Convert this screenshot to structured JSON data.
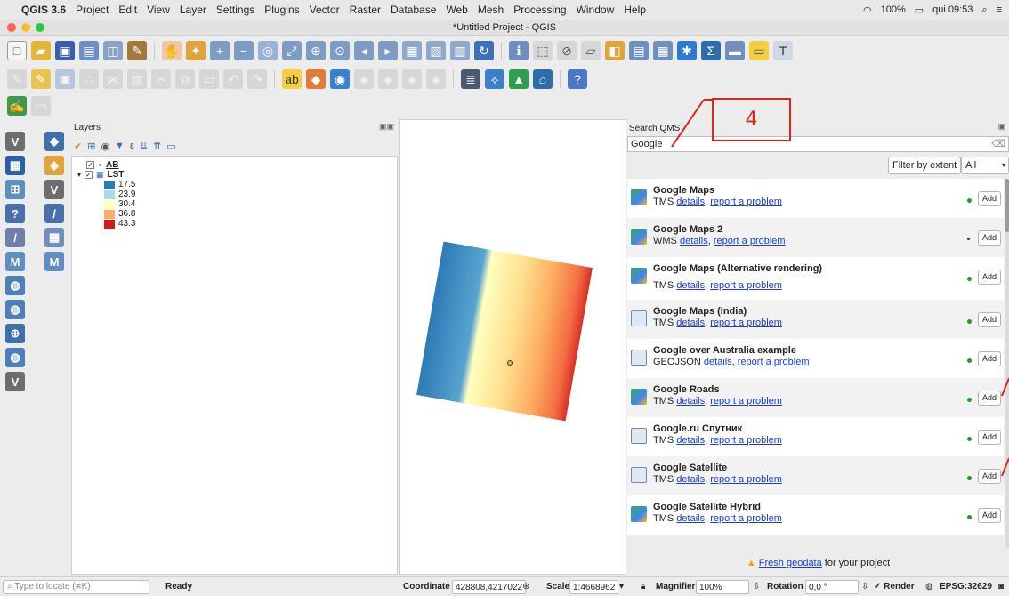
{
  "menubar": {
    "app_name": "QGIS 3.6",
    "items": [
      "Project",
      "Edit",
      "View",
      "Layer",
      "Settings",
      "Plugins",
      "Vector",
      "Raster",
      "Database",
      "Web",
      "Mesh",
      "Processing",
      "Window",
      "Help"
    ],
    "battery": "100%",
    "clock": "qui 09:53"
  },
  "window": {
    "title": "*Untitled Project - QGIS"
  },
  "layers_panel": {
    "title": "Layers",
    "layers": [
      {
        "name": "AB",
        "checked": true
      },
      {
        "name": "LST",
        "checked": true
      }
    ],
    "legend": [
      {
        "label": "17.5",
        "color": "#2c7bb6"
      },
      {
        "label": "23.9",
        "color": "#abd9e9"
      },
      {
        "label": "30.4",
        "color": "#ffffbf"
      },
      {
        "label": "36.8",
        "color": "#fdae61"
      },
      {
        "label": "43.3",
        "color": "#d7191c"
      }
    ]
  },
  "qms": {
    "title": "Search QMS",
    "search_value": "Google",
    "filter_button": "Filter by extent",
    "filter_select": "All",
    "services": [
      {
        "name": "Google Maps",
        "type": "TMS",
        "icon": "map-pin-icon"
      },
      {
        "name": "Google Maps 2",
        "type": "WMS",
        "icon": "map-pin-icon"
      },
      {
        "name": "Google Maps (Alternative rendering)",
        "type": "TMS",
        "icon": "map-pin-icon"
      },
      {
        "name": "Google Maps (India)",
        "type": "TMS",
        "icon": "folded-map-icon"
      },
      {
        "name": "Google over Australia example",
        "type": "GEOJSON",
        "icon": "folded-map-icon"
      },
      {
        "name": "Google Roads",
        "type": "TMS",
        "icon": "map-pin-icon"
      },
      {
        "name": "Google.ru Спутник",
        "type": "TMS",
        "icon": "folded-map-icon"
      },
      {
        "name": "Google Satellite",
        "type": "TMS",
        "icon": "folded-map-icon"
      },
      {
        "name": "Google Satellite Hybrid",
        "type": "TMS",
        "icon": "map-pin-icon"
      }
    ],
    "details_label": "details",
    "report_label": "report a problem",
    "add_label": "Add",
    "footer_link": "Fresh geodata",
    "footer_text": " for your project"
  },
  "annotation": {
    "number": "4"
  },
  "statusbar": {
    "locate_placeholder": "Type to locate (⌘K)",
    "ready": "Ready",
    "coordinate_label": "Coordinate",
    "coordinate_value": "428808,4217022",
    "scale_label": "Scale",
    "scale_value": "1:4668962",
    "magnifier_label": "Magnifier",
    "magnifier_value": "100%",
    "rotation_label": "Rotation",
    "rotation_value": "0,0 °",
    "render_label": "Render",
    "crs": "EPSG:32629"
  }
}
